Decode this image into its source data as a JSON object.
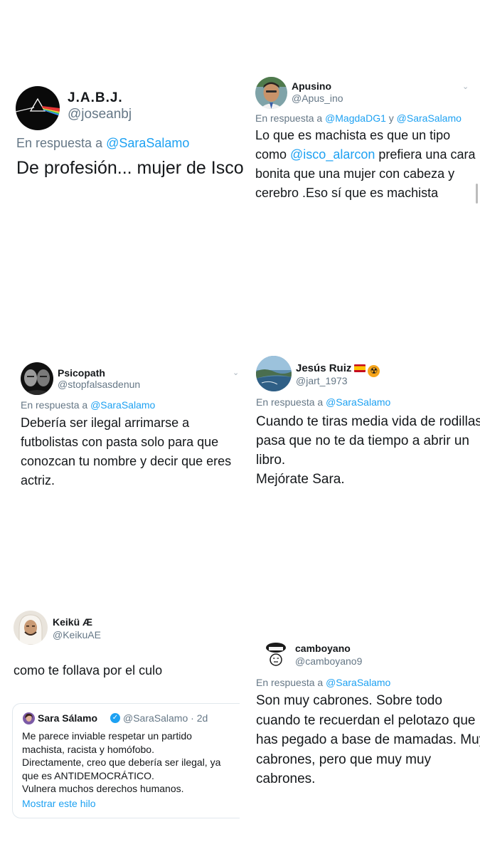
{
  "tweets": [
    {
      "id": "t1",
      "name": "J.A.B.J.",
      "handle": "@joseanbj",
      "reply_prefix": "En respuesta a",
      "reply_mentions": "@SaraSalamo",
      "body_lines": [
        "De profesión... mujer de Isco"
      ]
    },
    {
      "id": "t2",
      "name": "Apusino",
      "handle": "@Apus_ino",
      "reply_prefix": "En respuesta a",
      "reply_mention_1": "@MagdaDG1",
      "reply_joiner": "y",
      "reply_mention_2": "@SaraSalamo",
      "body_line_1": "Lo que es machista es que un tipo",
      "body_line_2_pre": "como",
      "body_line_2_mention": "@isco_alarcon",
      "body_line_2_post": "prefiera una cara",
      "body_line_3": "bonita que una mujer con cabeza y",
      "body_line_4": "cerebro .Eso sí que es machista"
    },
    {
      "id": "t3",
      "name": "Psicopath",
      "handle": "@stopfalsasdenun",
      "reply_prefix": "En respuesta a",
      "reply_mentions": "@SaraSalamo",
      "body_lines": [
        "Debería ser ilegal arrimarse a",
        "futbolistas con pasta solo para que",
        "conozcan tu nombre y decir que eres",
        "actriz."
      ]
    },
    {
      "id": "t4",
      "name": "Jesús Ruiz",
      "handle": "@jart_1973",
      "reply_prefix": "En respuesta a",
      "reply_mentions": "@SaraSalamo",
      "body_lines": [
        "Cuando te tiras media vida de rodillas",
        "pasa que no te da tiempo a abrir un",
        "libro.",
        "Mejórate Sara."
      ]
    },
    {
      "id": "t5",
      "name": "Keikü Æ",
      "handle": "@KeikuAE",
      "body_lines": [
        "como te follava por el culo"
      ],
      "quote": {
        "name": "Sara Sálamo",
        "meta": "@SaraSalamo · 2d",
        "text_lines": [
          "Me parece inviable respetar un partido",
          "machista, racista y homófobo.",
          "Directamente, creo que debería ser ilegal, ya",
          "que es ANTIDEMOCRÁTICO.",
          "Vulnera muchos derechos humanos."
        ],
        "link": "Mostrar este hilo"
      }
    },
    {
      "id": "t6",
      "name": "camboyano",
      "handle": "@camboyano9",
      "reply_prefix": "En respuesta a",
      "reply_mentions": "@SaraSalamo",
      "body_lines": [
        "Son muy cabrones. Sobre todo",
        "cuando te recuerdan el pelotazo que",
        "has pegado a base de mamadas. Muy",
        "cabrones, pero que muy muy",
        "cabrones."
      ]
    }
  ],
  "colors": {
    "link": "#1da1f2",
    "secondary": "#657786",
    "text": "#14171a"
  }
}
